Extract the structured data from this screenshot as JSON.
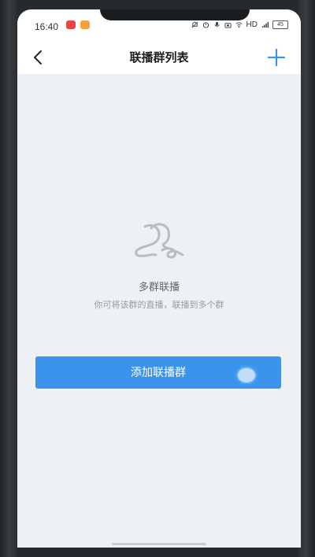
{
  "status_bar": {
    "time": "16:40",
    "network_label": "HD",
    "battery_level": "45",
    "app_icons": [
      "red-app-icon",
      "orange-app-icon"
    ],
    "status_icons": [
      "silent-icon",
      "alarm-icon",
      "mic-icon",
      "camera-icon",
      "wifi-icon",
      "signal-icon"
    ]
  },
  "nav": {
    "title": "联播群列表",
    "back_icon": "chevron-left-icon",
    "add_icon": "plus-icon"
  },
  "empty_state": {
    "icon": "multi-group-icon",
    "title": "多群联播",
    "description": "你可将该群的直播，联播到多个群"
  },
  "primary_button": {
    "label": "添加联播群"
  },
  "colors": {
    "accent": "#3a94ee",
    "background": "#eef1f3",
    "nav_background": "#ffffff"
  }
}
